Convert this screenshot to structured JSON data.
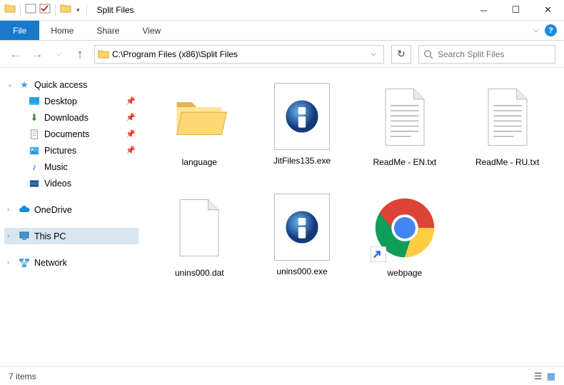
{
  "title": "Split Files",
  "ribbon": {
    "file": "File",
    "tabs": [
      "Home",
      "Share",
      "View"
    ]
  },
  "address": "C:\\Program Files (x86)\\Split Files",
  "search_placeholder": "Search Split Files",
  "sidebar": {
    "quick_access": "Quick access",
    "quick_items": [
      {
        "label": "Desktop",
        "icon": "desktop"
      },
      {
        "label": "Downloads",
        "icon": "downloads"
      },
      {
        "label": "Documents",
        "icon": "documents"
      },
      {
        "label": "Pictures",
        "icon": "pictures"
      },
      {
        "label": "Music",
        "icon": "music"
      },
      {
        "label": "Videos",
        "icon": "videos"
      }
    ],
    "onedrive": "OneDrive",
    "thispc": "This PC",
    "network": "Network"
  },
  "items": [
    {
      "label": "language",
      "type": "folder"
    },
    {
      "label": "JitFiles135.exe",
      "type": "info-exe"
    },
    {
      "label": "ReadMe - EN.txt",
      "type": "txt"
    },
    {
      "label": "ReadMe - RU.txt",
      "type": "txt"
    },
    {
      "label": "unins000.dat",
      "type": "blank"
    },
    {
      "label": "unins000.exe",
      "type": "info-exe"
    },
    {
      "label": "webpage",
      "type": "chrome-link"
    }
  ],
  "status": "7 items"
}
